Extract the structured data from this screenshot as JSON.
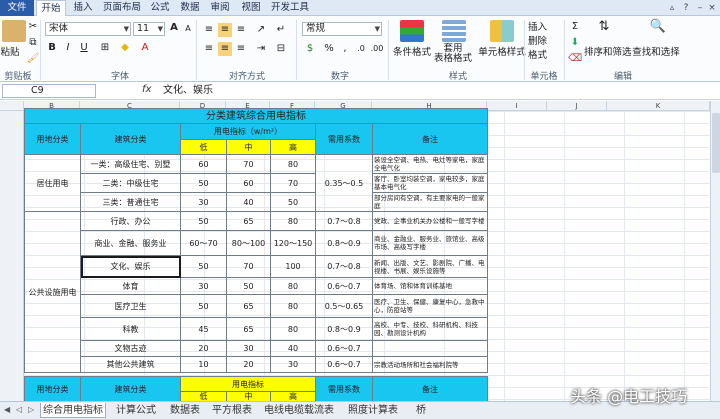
{
  "menu_tabs": [
    "文件",
    "开始",
    "插入",
    "页面布局",
    "公式",
    "数据",
    "审阅",
    "视图",
    "开发工具"
  ],
  "ribbon": {
    "paste_label": "粘贴",
    "font_name": "宋体",
    "font_size": "11",
    "number_format": "常规",
    "conditional_format": "条件格式",
    "format_as_table": "套用\n表格格式",
    "cell_styles": "单元格样式",
    "insert": "插入",
    "delete": "删除",
    "format": "格式",
    "sort_filter": "排序和筛选",
    "find_select": "查找和选择",
    "groups": [
      "剪贴板",
      "字体",
      "对齐方式",
      "数字",
      "样式",
      "单元格",
      "编辑"
    ],
    "bold": "B",
    "italic": "I",
    "underline": "U",
    "grow_font": "A",
    "shrink_font": "A"
  },
  "formula_bar": {
    "name_box": "C9",
    "fx": "fx",
    "content": "文化、娱乐"
  },
  "columns": [
    "B",
    "C",
    "D",
    "E",
    "F",
    "G",
    "H",
    "I",
    "J",
    "K"
  ],
  "table1": {
    "title": "分类建筑综合用电指标",
    "h_category": "用地分类",
    "h_building": "建筑分类",
    "h_index": "用电指标（w/m²）",
    "h_low": "低",
    "h_mid": "中",
    "h_high": "高",
    "h_demand": "需用系数",
    "h_remark": "备注",
    "group1": "居住用电",
    "group2": "公共设施用电",
    "rows": [
      {
        "b": "一类：高级住宅、别墅",
        "l": "60",
        "m": "70",
        "h": "80",
        "d": "",
        "r": "装设全空调、电热、电灶等家电，家庭全电气化"
      },
      {
        "b": "二类：中级住宅",
        "l": "50",
        "m": "60",
        "h": "70",
        "d": "0.35～0.5",
        "r": "客厅、卧室均装空调，家电较多，家庭基本电气化"
      },
      {
        "b": "三类：普通住宅",
        "l": "30",
        "m": "40",
        "h": "50",
        "d": "",
        "r": "部分房间有空调，有主要家电的一般家庭"
      },
      {
        "b": "行政、办公",
        "l": "50",
        "m": "65",
        "h": "80",
        "d": "0.7～0.8",
        "r": "党政、企事业机关办公楼和一般写字楼"
      },
      {
        "b": "商业、金融、服务业",
        "l": "60～70",
        "m": "80～100",
        "h": "120～150",
        "d": "0.8～0.9",
        "r": "商业、金融业、服务业、旅馆业、高级市场、高级写字楼"
      },
      {
        "b": "文化、娱乐",
        "l": "50",
        "m": "70",
        "h": "100",
        "d": "0.7～0.8",
        "r": "新闻、出版、文艺、影剧院、广播、电视楼、书展、娱乐设施等"
      },
      {
        "b": "体育",
        "l": "30",
        "m": "50",
        "h": "80",
        "d": "0.6～0.7",
        "r": "体育场、馆和体育训练基地"
      },
      {
        "b": "医疗卫生",
        "l": "50",
        "m": "65",
        "h": "80",
        "d": "0.5～0.65",
        "r": "医疗、卫生、保健、康复中心，急救中心，防疫站等"
      },
      {
        "b": "科教",
        "l": "45",
        "m": "65",
        "h": "80",
        "d": "0.8～0.9",
        "r": "高校、中专、技校、科研机构、科技园、勘测设计机构"
      },
      {
        "b": "文物古迹",
        "l": "20",
        "m": "30",
        "h": "40",
        "d": "0.6～0.7",
        "r": ""
      },
      {
        "b": "其他公共建筑",
        "l": "10",
        "m": "20",
        "h": "30",
        "d": "0.6～0.7",
        "r": "宗教活动场所和社会福利院等"
      }
    ]
  },
  "table2": {
    "h_category": "用地分类",
    "h_building": "建筑分类",
    "h_index": "用电指标",
    "h_low": "低",
    "h_mid": "中",
    "h_high": "高",
    "h_demand": "需用系数",
    "h_remark": "备注"
  },
  "sheet_tabs": [
    "综合用电指标",
    "计算公式",
    "数据表",
    "平方根表",
    "电线电缆载流表",
    "照度计算表",
    "桥"
  ],
  "watermark": "头条 @电工技巧"
}
